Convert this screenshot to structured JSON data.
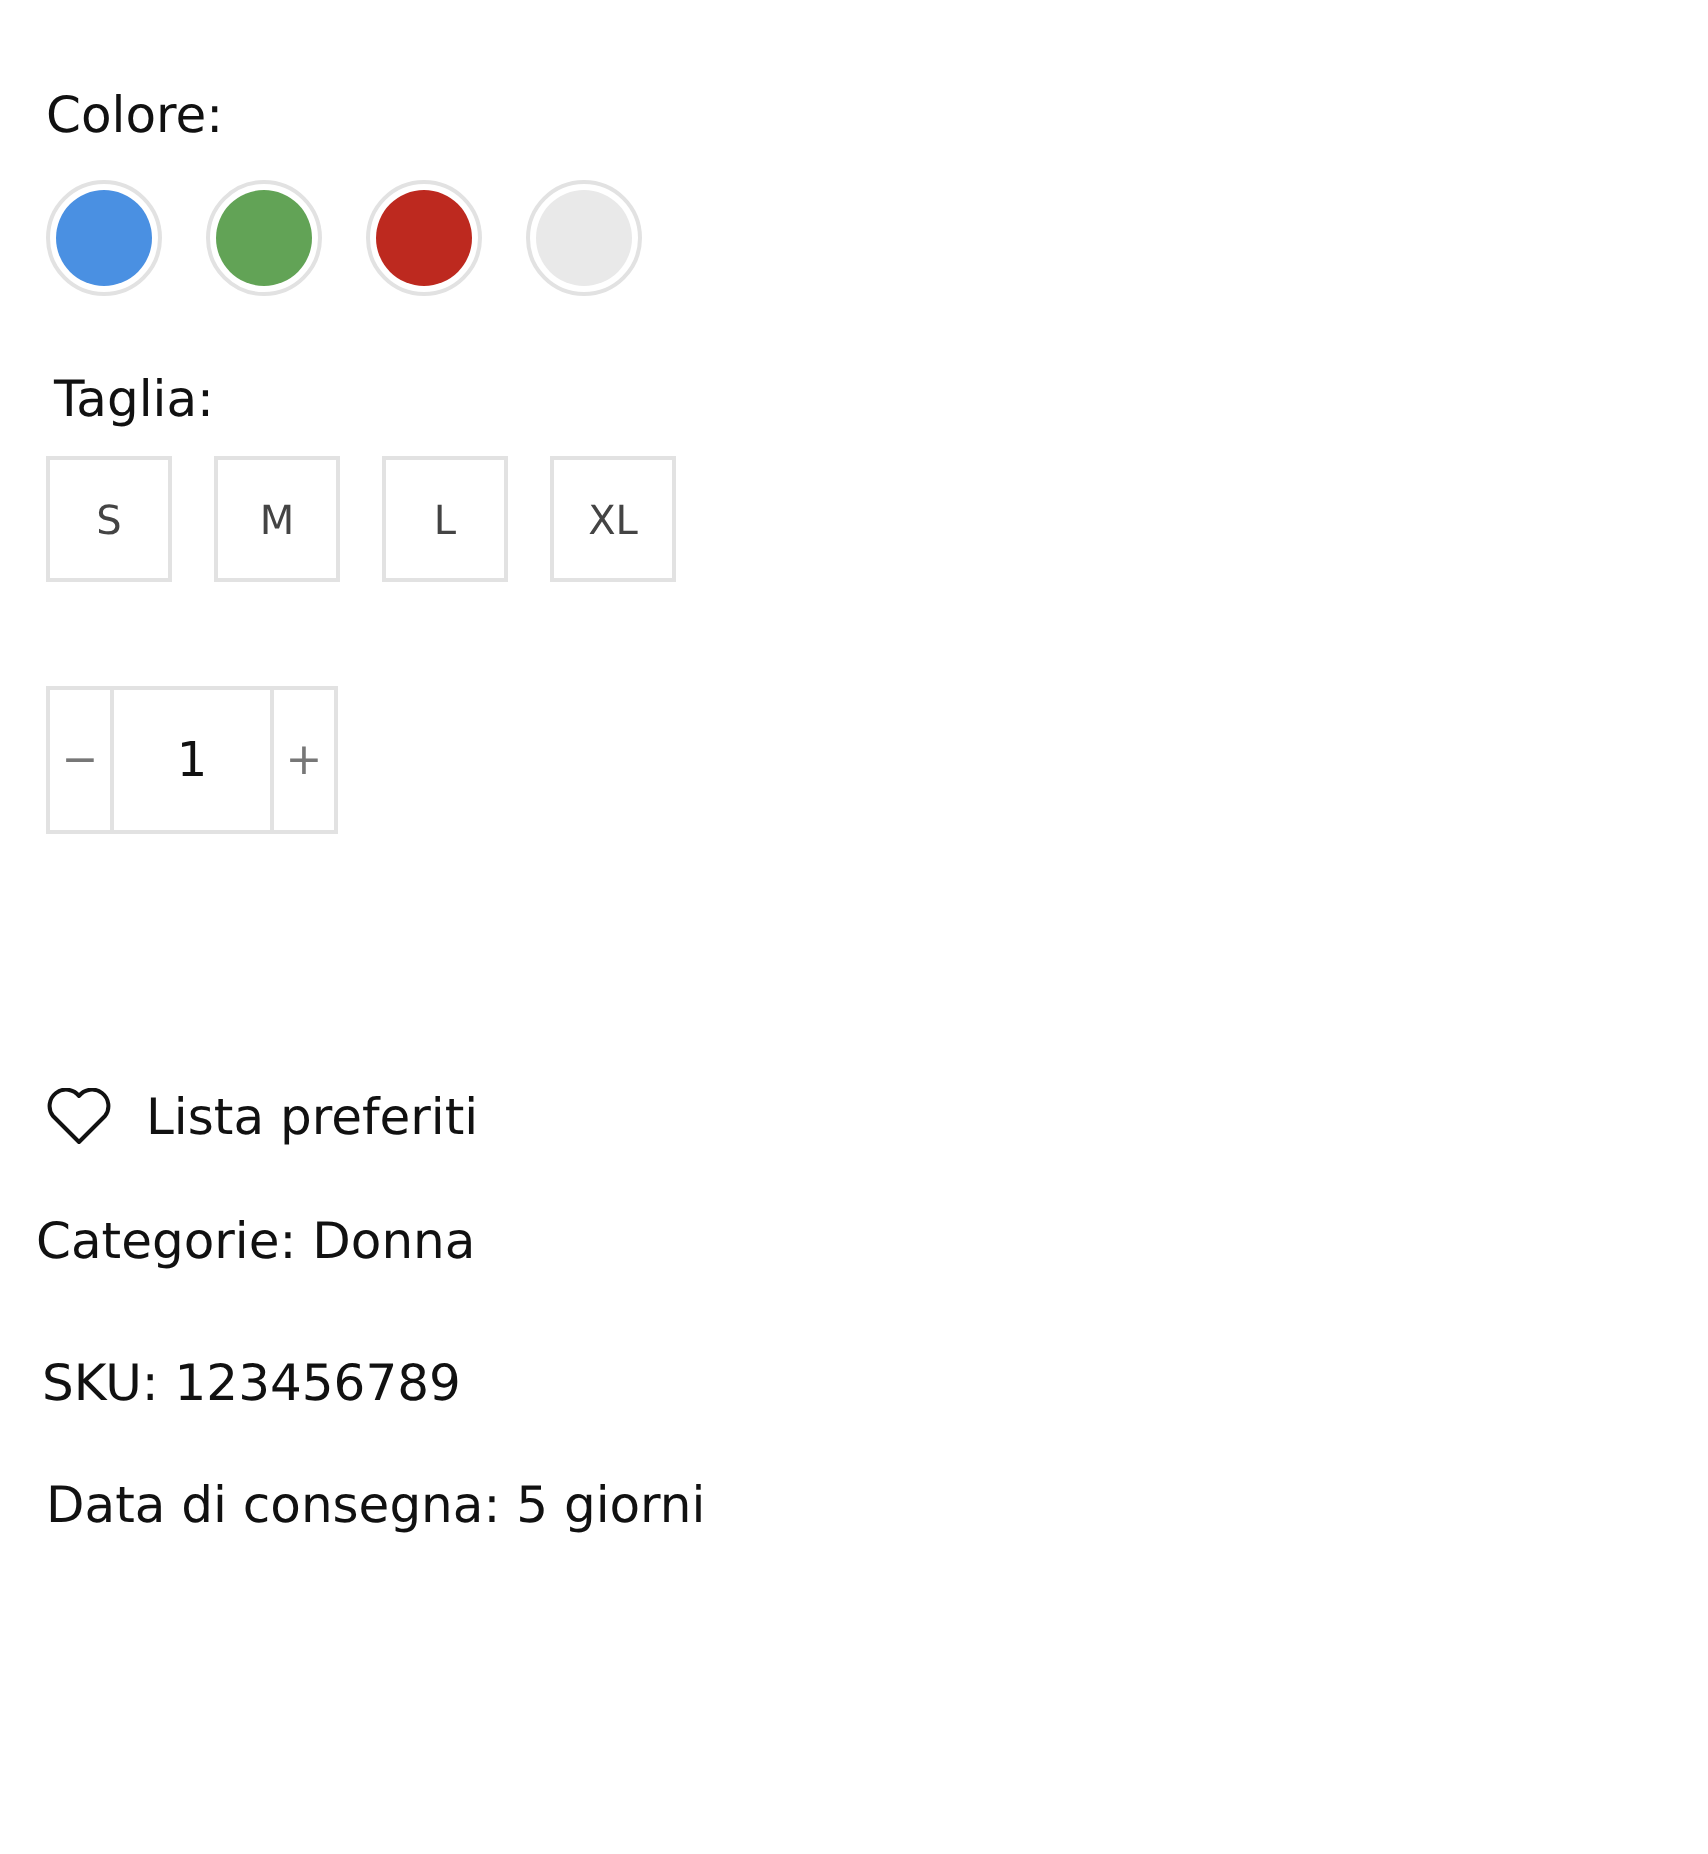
{
  "color_label": "Colore:",
  "colors": [
    {
      "color": "#4a90e2",
      "selected": false
    },
    {
      "color": "#62a356",
      "selected": false
    },
    {
      "color": "#bd291f",
      "selected": false
    },
    {
      "color": "#e9e9e9",
      "selected": false
    }
  ],
  "size_label": "Taglia:",
  "sizes": [
    {
      "label": "S",
      "selected": false
    },
    {
      "label": "M",
      "selected": false
    },
    {
      "label": "L",
      "selected": false
    },
    {
      "label": "XL",
      "selected": false
    }
  ],
  "quantity": {
    "minus": "−",
    "value": "1",
    "plus": "+"
  },
  "wishlist": "Lista preferiti",
  "category": {
    "label": "Categorie:",
    "value": "Donna"
  },
  "sku": "SKU: 123456789",
  "delivery": "Data di consegna: 5 giorni"
}
